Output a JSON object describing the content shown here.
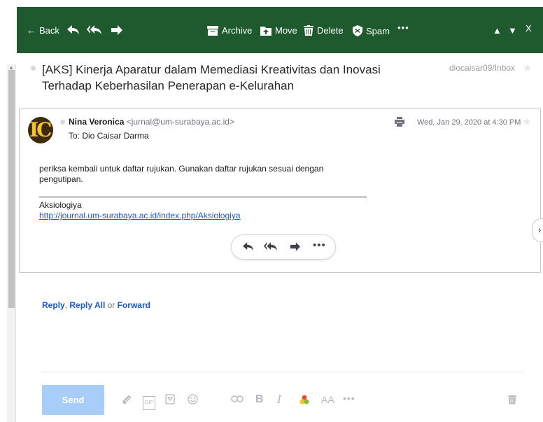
{
  "toolbar": {
    "back_label": "Back",
    "archive_label": "Archive",
    "move_label": "Move",
    "delete_label": "Delete",
    "spam_label": "Spam",
    "more_label": "•••",
    "prev_glyph": "▲",
    "next_glyph": "▼",
    "close_glyph": "X",
    "background_color": "#1f5a2f"
  },
  "subject": {
    "text": "[AKS] Kinerja Aparatur dalam Memediasi Kreativitas dan Inovasi Terhadap Keberhasilan Penerapan e-Kelurahan",
    "folder": "diocaisar09/Inbox"
  },
  "message": {
    "avatar_text": "IC",
    "sender_name": "Nina Veronica",
    "sender_email": "<jurnal@um-surabaya.ac.id>",
    "to": "To: Dio Caisar Darma",
    "date": "Wed, Jan 29, 2020 at 4:30 PM",
    "body_lines": [
      "periksa kembali untuk daftar rujukan. Gunakan daftar rujukan sesuai dengan",
      "pengutipan."
    ],
    "signature_name": "Aksiologiya",
    "signature_link": "http://journal.um-surabaya.ac.id/index.php/Aksiologiya",
    "pill_more": "•••"
  },
  "reply_links": {
    "reply": "Reply",
    "sep1": ",",
    "reply_all": "Reply All",
    "or": "or",
    "forward": "Forward"
  },
  "compose": {
    "send_label": "Send",
    "gif_label": "GIF",
    "bold_label": "B",
    "italic_label": "I",
    "font_label": "AA",
    "more_label": "•••",
    "send_color": "#a8cdf8"
  }
}
